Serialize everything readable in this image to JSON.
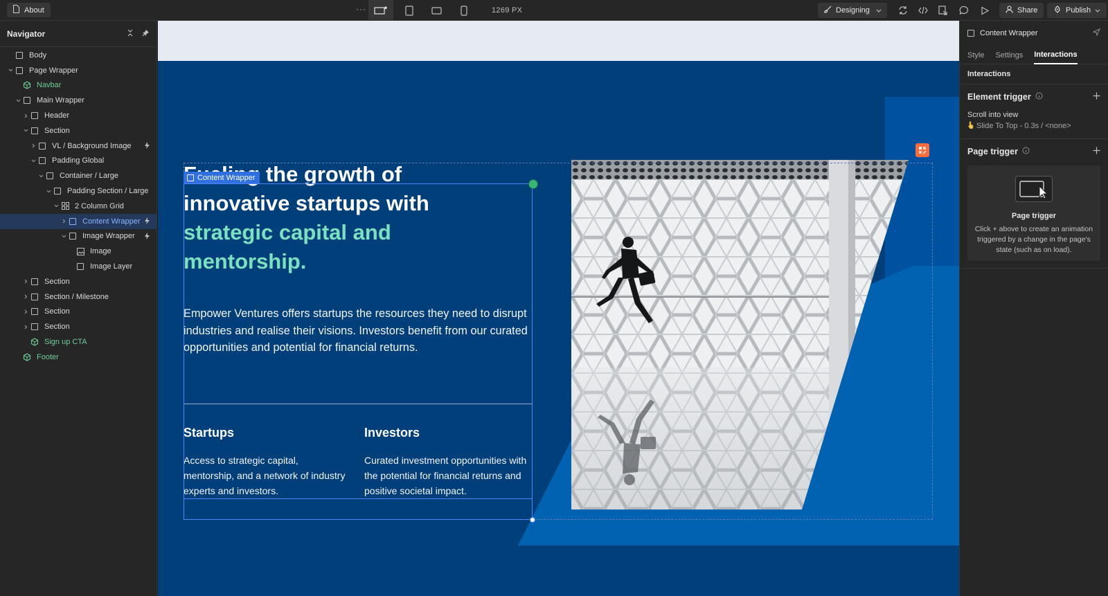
{
  "topbar": {
    "page_name": "About",
    "more": "···",
    "width_readout": "1269 PX",
    "mode": "Designing",
    "share": "Share",
    "publish": "Publish"
  },
  "navigator": {
    "title": "Navigator",
    "items": [
      {
        "label": "Body",
        "depth": 0,
        "caret": "",
        "icon": "box-icon",
        "kind": "element"
      },
      {
        "label": "Page Wrapper",
        "depth": 0,
        "caret": "open",
        "icon": "box-icon",
        "kind": "element"
      },
      {
        "label": "Navbar",
        "depth": 1,
        "caret": "",
        "icon": "component-icon",
        "kind": "component"
      },
      {
        "label": "Main Wrapper",
        "depth": 1,
        "caret": "open",
        "icon": "box-icon",
        "kind": "element"
      },
      {
        "label": "Header",
        "depth": 2,
        "caret": "closed",
        "icon": "box-icon",
        "kind": "element"
      },
      {
        "label": "Section",
        "depth": 2,
        "caret": "open",
        "icon": "box-icon",
        "kind": "element"
      },
      {
        "label": "VL / Background Image",
        "depth": 3,
        "caret": "closed",
        "icon": "box-icon",
        "kind": "element",
        "bolt": true
      },
      {
        "label": "Padding Global",
        "depth": 3,
        "caret": "open",
        "icon": "box-icon",
        "kind": "element"
      },
      {
        "label": "Container / Large",
        "depth": 4,
        "caret": "open",
        "icon": "box-icon",
        "kind": "element"
      },
      {
        "label": "Padding Section / Large",
        "depth": 5,
        "caret": "open",
        "icon": "box-icon",
        "kind": "element"
      },
      {
        "label": "2 Column Grid",
        "depth": 6,
        "caret": "open",
        "icon": "grid-icon",
        "kind": "element"
      },
      {
        "label": "Content Wrapper",
        "depth": 7,
        "caret": "closed",
        "icon": "box-icon",
        "kind": "element",
        "bolt": true,
        "selected": true
      },
      {
        "label": "Image Wrapper",
        "depth": 7,
        "caret": "open",
        "icon": "box-icon",
        "kind": "element",
        "bolt": true
      },
      {
        "label": "Image",
        "depth": 8,
        "caret": "",
        "icon": "image-icon",
        "kind": "element"
      },
      {
        "label": "Image Layer",
        "depth": 8,
        "caret": "",
        "icon": "box-icon",
        "kind": "element"
      },
      {
        "label": "Section",
        "depth": 2,
        "caret": "closed",
        "icon": "box-icon",
        "kind": "element"
      },
      {
        "label": "Section / Milestone",
        "depth": 2,
        "caret": "closed",
        "icon": "box-icon",
        "kind": "element"
      },
      {
        "label": "Section",
        "depth": 2,
        "caret": "closed",
        "icon": "box-icon",
        "kind": "element"
      },
      {
        "label": "Section",
        "depth": 2,
        "caret": "closed",
        "icon": "box-icon",
        "kind": "element"
      },
      {
        "label": "Sign up CTA",
        "depth": 2,
        "caret": "",
        "icon": "component-icon",
        "kind": "component"
      },
      {
        "label": "Footer",
        "depth": 1,
        "caret": "",
        "icon": "component-icon",
        "kind": "component"
      }
    ]
  },
  "canvas": {
    "selection_label": "Content Wrapper",
    "hero": {
      "title_white": "Fueling the growth of innovative startups with",
      "title_accent": "strategic capital and mentorship.",
      "body": "Empower Ventures offers startups the resources they need to disrupt industries and realise their visions. Investors benefit from our curated opportunities and potential for financial returns."
    },
    "columns": [
      {
        "heading": "Startups",
        "text": "Access to strategic capital, mentorship, and a network of industry experts and investors."
      },
      {
        "heading": "Investors",
        "text": "Curated investment opportunities with the potential for financial returns and positive societal impact."
      }
    ]
  },
  "panel": {
    "element_name": "Content Wrapper",
    "tabs": [
      "Style",
      "Settings",
      "Interactions"
    ],
    "active_tab": "Interactions",
    "section_title": "Interactions",
    "element_trigger": {
      "title": "Element trigger",
      "name": "Scroll into view",
      "detail": "Slide To Top - 0.3s / <none>"
    },
    "page_trigger": {
      "title": "Page trigger",
      "empty_title": "Page trigger",
      "empty_desc": "Click + above to create an animation triggered by a change in the page's state (such as on load)."
    }
  },
  "colors": {
    "canvas_bg": "#003f7a",
    "accent_blue": "#0062b0",
    "accent_green": "#7ae1c1",
    "selection": "#2f6fe0"
  }
}
